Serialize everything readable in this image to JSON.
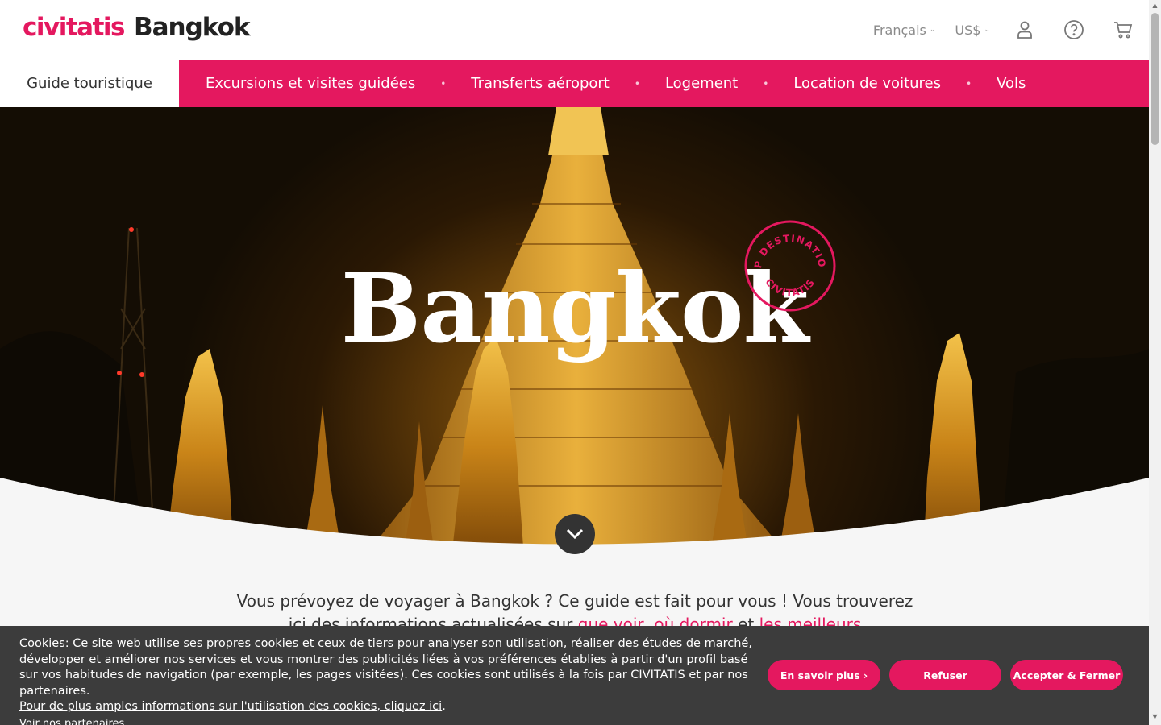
{
  "header": {
    "brand": "civitatis",
    "city": "Bangkok",
    "language": "Français",
    "currency": "US$",
    "icons": [
      "user-icon",
      "help-icon",
      "cart-icon"
    ]
  },
  "nav": {
    "guide": "Guide touristique",
    "items": [
      "Excursions et visites guidées",
      "Transferts aéroport",
      "Logement",
      "Location de voitures",
      "Vols"
    ]
  },
  "hero": {
    "title": "Bangkok",
    "stamp_top": "TOP DESTINATIONS",
    "stamp_bottom": "CIVITATIS"
  },
  "intro": {
    "line1": "Vous prévoyez de voyager à Bangkok ? Ce guide est fait pour vous ! Vous trouverez",
    "line2_a": "ici des informations actualisées sur ",
    "link1": "que voir, où dormir",
    "line2_b": " et ",
    "link2": "les meilleurs"
  },
  "cookie": {
    "text": "Cookies: Ce site web utilise ses propres cookies et ceux de tiers pour analyser son utilisation, réaliser des études de marché, développer et améliorer nos services et vous montrer des publicités liées à vos préférences établies à partir d'un profil basé sur vos habitudes de navigation (par exemple, les pages visitées). Ces cookies sont utilisés à la fois par CIVITATIS et par nos partenaires.",
    "more_link": "Pour de plus amples informations sur l'utilisation des cookies, cliquez ici",
    "period": ".",
    "partners_link": "Voir nos partenaires",
    "btn_more": "En savoir plus ›",
    "btn_refuse": "Refuser",
    "btn_accept": "Accepter & Fermer"
  },
  "colors": {
    "accent": "#e4185f",
    "cookie_bg": "#3c3c3c",
    "text": "#333333"
  }
}
